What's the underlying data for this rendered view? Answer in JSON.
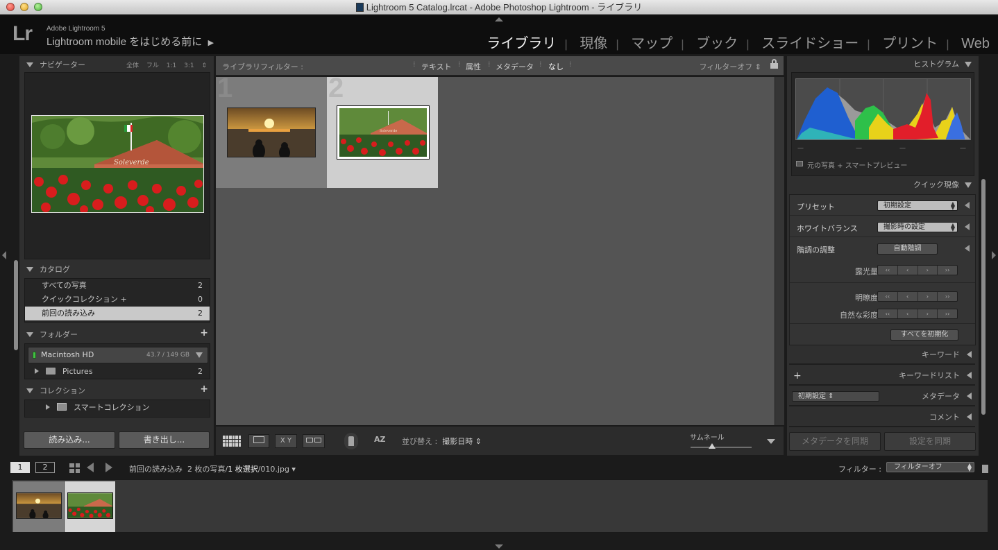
{
  "window": {
    "title": "Lightroom 5 Catalog.lrcat - Adobe Photoshop Lightroom - ライブラリ"
  },
  "identity": {
    "logo": "Lr",
    "product": "Adobe Lightroom 5",
    "tagline": "Lightroom mobile をはじめる前に",
    "tagline_arrow": "▶"
  },
  "modules": [
    "ライブラリ",
    "現像",
    "マップ",
    "ブック",
    "スライドショー",
    "プリント",
    "Web"
  ],
  "module_active": "ライブラリ",
  "navigator": {
    "title": "ナビゲーター",
    "zoom_options": [
      "全体",
      "フル",
      "1:1",
      "3:1"
    ],
    "zoom_more": "⇕"
  },
  "catalog": {
    "title": "カタログ",
    "items": [
      {
        "label": "すべての写真",
        "count": "2"
      },
      {
        "label": "クイックコレクション +",
        "count": "0"
      },
      {
        "label": "前回の読み込み",
        "count": "2"
      }
    ],
    "selected_index": 2
  },
  "folders": {
    "title": "フォルダー",
    "add": "+",
    "volume": {
      "name": "Macintosh HD",
      "size": "43.7 / 149 GB"
    },
    "items": [
      {
        "label": "Pictures",
        "count": "2"
      }
    ]
  },
  "collections": {
    "title": "コレクション",
    "add": "+",
    "items": [
      {
        "label": "スマートコレクション"
      }
    ]
  },
  "left_buttons": {
    "import": "読み込み...",
    "export": "書き出し..."
  },
  "filter_bar": {
    "label": "ライブラリフィルター :",
    "options": [
      "テキスト",
      "属性",
      "メタデータ",
      "なし"
    ],
    "active_option": "なし",
    "preset": "フィルターオフ ⇕"
  },
  "grid": {
    "cells": [
      {
        "index": "1",
        "photo": "sunset",
        "selected": false
      },
      {
        "index": "2",
        "photo": "roses",
        "selected": true
      }
    ]
  },
  "toolbar": {
    "view_loupe_label": "",
    "view_compare_label": "X Y",
    "sort_icon": "AZ",
    "sort_label": "並び替え :",
    "sort_value": "撮影日時 ⇕",
    "thumbnail_label": "サムネール",
    "thumbnail_size": 0.35
  },
  "right_panel": {
    "histogram": {
      "title": "ヒストグラム",
      "ticks": [
        "—",
        "—",
        "—",
        "—"
      ],
      "footer": "元の写真 + スマートプレビュー"
    },
    "quick_develop": {
      "title": "クイック現像",
      "preset_label": "プリセット",
      "preset_value": "初期設定",
      "wb_label": "ホワイトバランス",
      "wb_value": "撮影時の設定",
      "tone_label": "階調の調整",
      "auto_tone": "自動階調",
      "exposure": "露光量",
      "clarity": "明瞭度",
      "vibrance": "自然な彩度",
      "stepper": [
        "‹‹",
        "‹",
        "›",
        "››"
      ],
      "reset_all": "すべてを初期化"
    },
    "keywording": {
      "title": "キーワード"
    },
    "keyword_list": {
      "title": "キーワードリスト",
      "add": "+"
    },
    "metadata": {
      "title": "メタデータ",
      "preset": "初期設定 ⇕"
    },
    "comments": {
      "title": "コメント"
    },
    "sync_metadata": "メタデータを同期",
    "sync_settings": "設定を同期"
  },
  "filmstrip_bar": {
    "screen1": "1",
    "screen2": "2",
    "source": "前回の読み込み",
    "counts": "2 枚の写真/",
    "selection": "1 枚選択",
    "filename": "/010.jpg ▾",
    "filter_label": "フィルター :",
    "filter_value": "フィルターオフ"
  },
  "colors": {
    "accent_selected_cell": "#cfcfcf",
    "cell_normal": "#7c7c7c",
    "grid_bg": "#545454",
    "panel_bg": "#2f2f2f"
  }
}
